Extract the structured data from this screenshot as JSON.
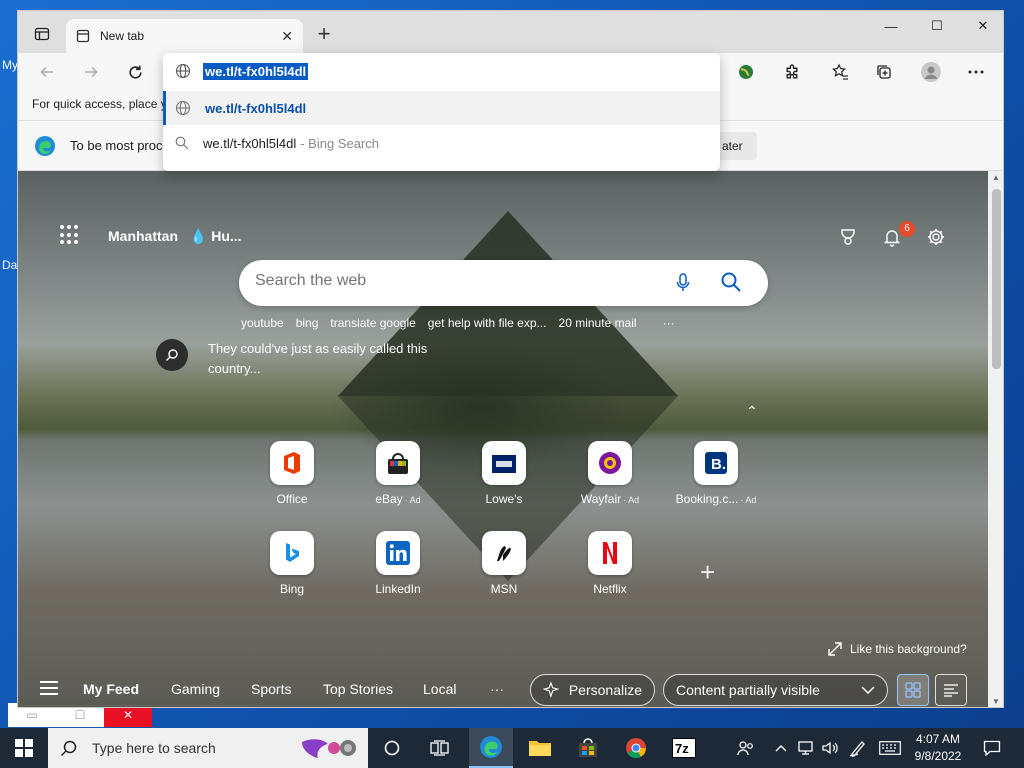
{
  "desktop": {
    "fragments": [
      "My",
      "Da"
    ],
    "ghost_window": {
      "close_label": "✕"
    }
  },
  "browser": {
    "tab": {
      "title": "New tab",
      "close_glyph": "✕"
    },
    "new_tab_glyph": "+",
    "window_controls": {
      "minimize": "—",
      "maximize": "☐",
      "close": "✕"
    },
    "favorites_hint": "For quick access, place y",
    "infobar": {
      "message": "To be most proc",
      "later_label": "ater"
    },
    "omnibox": {
      "input_text": "we.tl/t-fx0hl5l4dl",
      "suggestions": [
        {
          "text": "we.tl/t-fx0hl5l4dl",
          "type": "url",
          "selected": true
        },
        {
          "text": "we.tl/t-fx0hl5l4dl",
          "suffix": "- Bing Search",
          "type": "search",
          "selected": false
        }
      ]
    }
  },
  "newtab": {
    "weather": {
      "city": "Manhattan",
      "condition": "Hu..."
    },
    "notification_count": "6",
    "search": {
      "placeholder": "Search the web"
    },
    "quick_links": [
      "youtube",
      "bing",
      "translate google",
      "get help with file exp...",
      "20 minute mail"
    ],
    "quick_links_more": "···",
    "trending": "They could've just as easily called this country...",
    "tiles": [
      {
        "label": "Office",
        "ad": "",
        "icon": "office-icon"
      },
      {
        "label": "eBay",
        "ad": "· Ad",
        "icon": "ebay-icon"
      },
      {
        "label": "Lowe's",
        "ad": "",
        "icon": "lowes-icon"
      },
      {
        "label": "Wayfair",
        "ad": "· Ad",
        "icon": "wayfair-icon"
      },
      {
        "label": "Booking.c...",
        "ad": "· Ad",
        "icon": "booking-icon"
      },
      {
        "label": "Bing",
        "ad": "",
        "icon": "bing-icon"
      },
      {
        "label": "LinkedIn",
        "ad": "",
        "icon": "linkedin-icon"
      },
      {
        "label": "MSN",
        "ad": "",
        "icon": "msn-icon"
      },
      {
        "label": "Netflix",
        "ad": "",
        "icon": "netflix-icon"
      }
    ],
    "add_tile_glyph": "+",
    "like_background": "Like this background?",
    "feed": {
      "tabs": [
        "My Feed",
        "Gaming",
        "Sports",
        "Top Stories",
        "Local"
      ],
      "more": "···",
      "personalize_label": "Personalize",
      "content_visibility": "Content partially visible"
    }
  },
  "taskbar": {
    "search_placeholder": "Type here to search",
    "time": "4:07 AM",
    "date": "9/8/2022"
  },
  "colors": {
    "accent": "#0a5cc5",
    "taskbar": "#1d2936",
    "close_red": "#e81123",
    "badge": "#e74a2a"
  }
}
